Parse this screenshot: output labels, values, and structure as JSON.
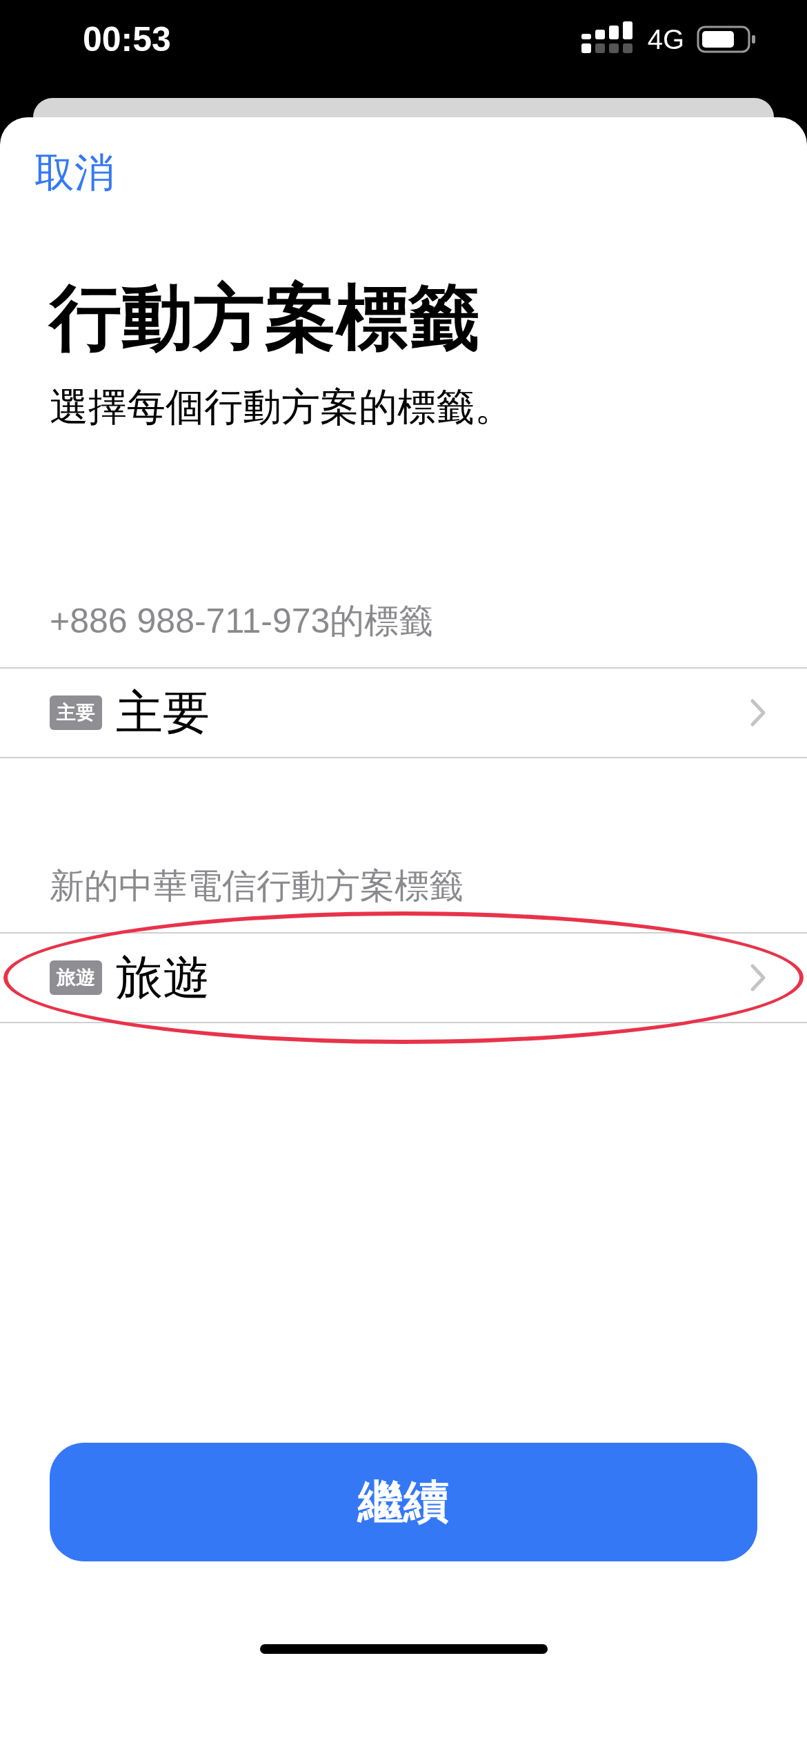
{
  "status_bar": {
    "time": "00:53",
    "network": "4G"
  },
  "cancel": "取消",
  "title": "行動方案標籤",
  "subtitle": "選擇每個行動方案的標籤。",
  "sections": [
    {
      "header": "+886 988-711-973的標籤",
      "items": [
        {
          "badge": "主要",
          "label": "主要",
          "circled": false
        }
      ]
    },
    {
      "header": "新的中華電信行動方案標籤",
      "items": [
        {
          "badge": "旅遊",
          "label": "旅遊",
          "circled": true
        }
      ]
    }
  ],
  "continue_button": "繼續"
}
